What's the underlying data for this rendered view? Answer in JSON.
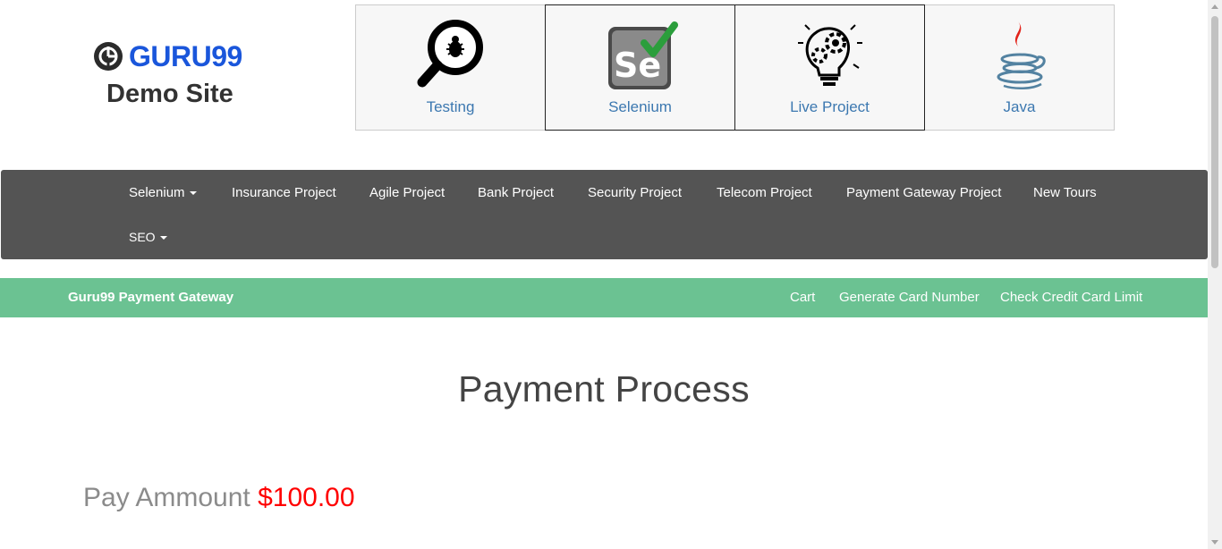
{
  "logo": {
    "brand": "GURU99",
    "subtitle": "Demo Site",
    "icon": "guru99-logo-icon",
    "brand_color": "#1a56db"
  },
  "tiles": [
    {
      "label": "Testing",
      "icon": "magnifier-bug-icon"
    },
    {
      "label": "Selenium",
      "icon": "selenium-icon"
    },
    {
      "label": "Live Project",
      "icon": "lightbulb-gears-icon"
    },
    {
      "label": "Java",
      "icon": "java-icon"
    }
  ],
  "mainnav": {
    "items": [
      {
        "label": "Selenium",
        "dropdown": true
      },
      {
        "label": "Insurance Project",
        "dropdown": false
      },
      {
        "label": "Agile Project",
        "dropdown": false
      },
      {
        "label": "Bank Project",
        "dropdown": false
      },
      {
        "label": "Security Project",
        "dropdown": false
      },
      {
        "label": "Telecom Project",
        "dropdown": false
      },
      {
        "label": "Payment Gateway Project",
        "dropdown": false
      },
      {
        "label": "New Tours",
        "dropdown": false
      },
      {
        "label": "SEO",
        "dropdown": true
      }
    ],
    "background": "#545454"
  },
  "payment_nav": {
    "brand": "Guru99 Payment Gateway",
    "links": [
      "Cart",
      "Generate Card Number",
      "Check Credit Card Limit"
    ],
    "background": "#6bc292"
  },
  "main": {
    "headline": "Payment Process",
    "pay_label": "Pay Ammount",
    "pay_amount": "$100.00",
    "amount_color": "#ff0000"
  }
}
